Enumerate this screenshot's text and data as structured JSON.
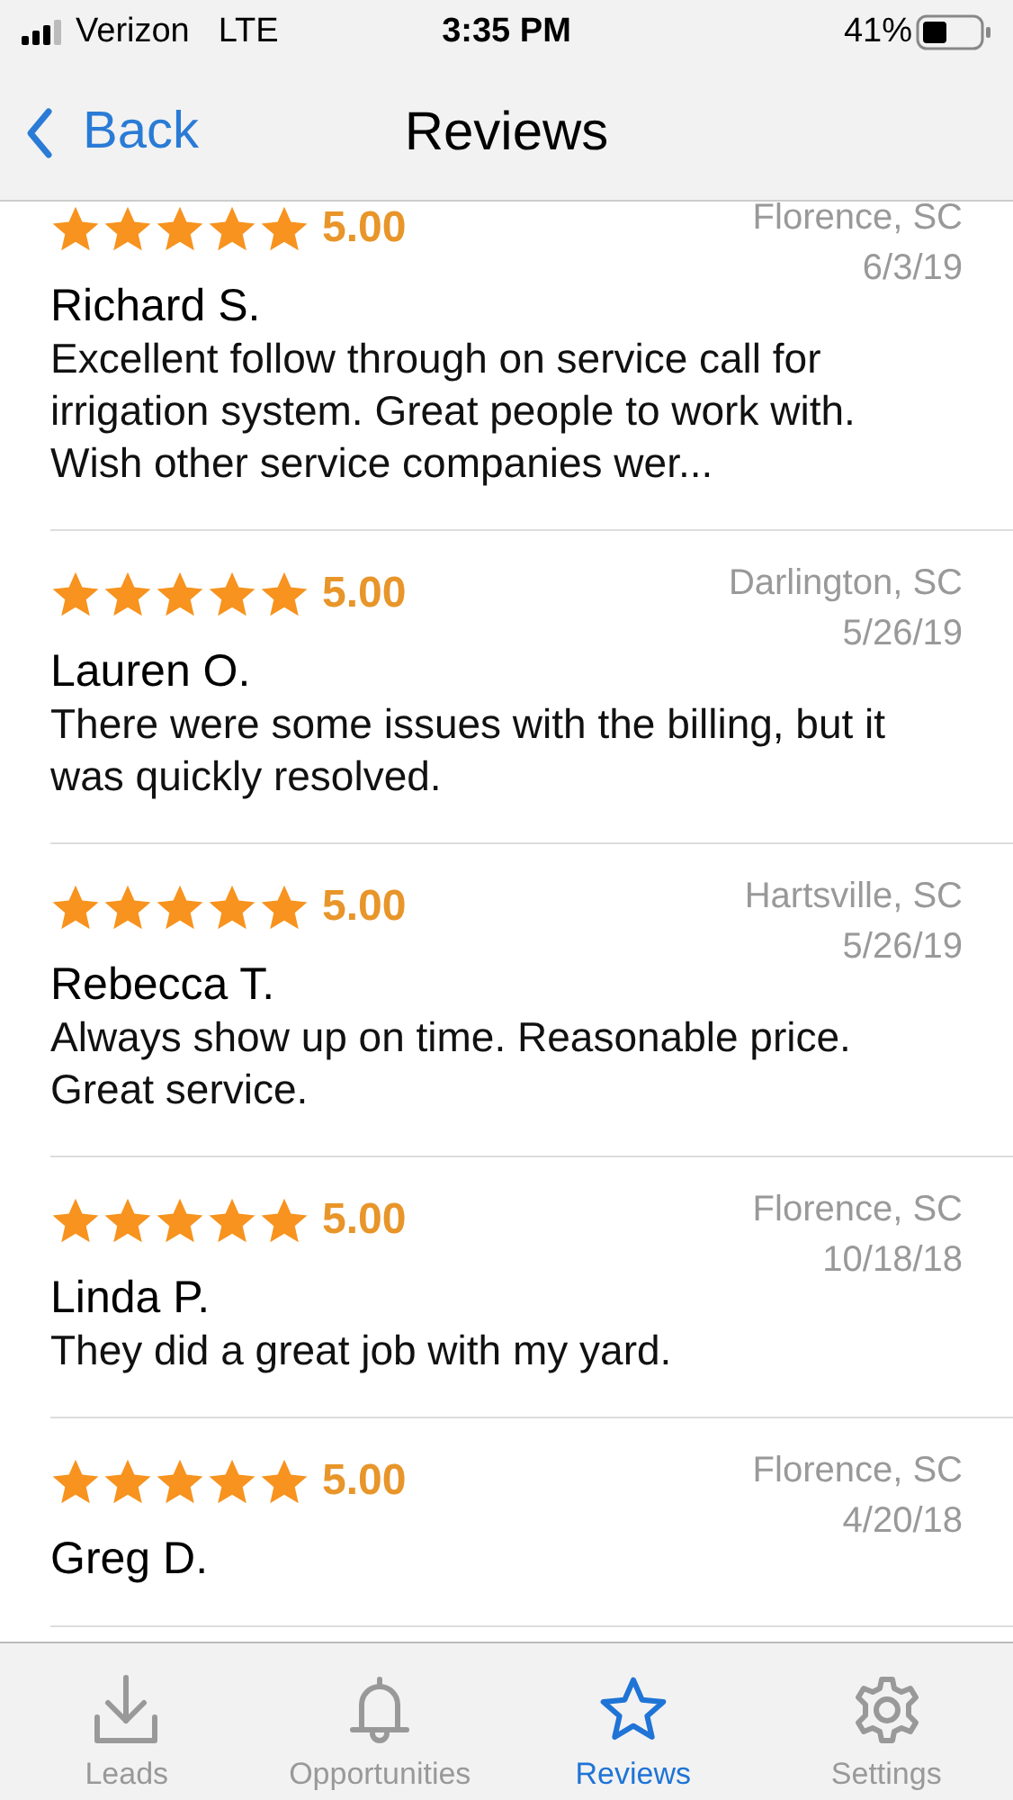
{
  "status_bar": {
    "carrier": "Verizon",
    "network": "LTE",
    "time": "3:35 PM",
    "battery": "41%"
  },
  "nav": {
    "back": "Back",
    "title": "Reviews"
  },
  "reviews": [
    {
      "stars": 5,
      "rating": "5.00",
      "location": "Florence, SC",
      "date": "6/3/19",
      "name": "Richard S.",
      "text": "Excellent follow through on service call for irrigation system. Great people to work with. Wish other service companies wer..."
    },
    {
      "stars": 5,
      "rating": "5.00",
      "location": "Darlington, SC",
      "date": "5/26/19",
      "name": "Lauren O.",
      "text": "There were some issues with the billing, but it was quickly resolved."
    },
    {
      "stars": 5,
      "rating": "5.00",
      "location": "Hartsville, SC",
      "date": "5/26/19",
      "name": "Rebecca T.",
      "text": "Always show up on time. Reasonable price. Great service."
    },
    {
      "stars": 5,
      "rating": "5.00",
      "location": "Florence, SC",
      "date": "10/18/18",
      "name": "Linda P.",
      "text": "They did a great job with my yard."
    },
    {
      "stars": 5,
      "rating": "5.00",
      "location": "Florence, SC",
      "date": "4/20/18",
      "name": "Greg D."
    }
  ],
  "tabs": [
    {
      "kind": "leads",
      "label": "Leads",
      "selected": false
    },
    {
      "kind": "opportunities",
      "label": "Opportunities",
      "selected": false
    },
    {
      "kind": "reviews",
      "label": "Reviews",
      "selected": true
    },
    {
      "kind": "settings",
      "label": "Settings",
      "selected": false
    }
  ]
}
